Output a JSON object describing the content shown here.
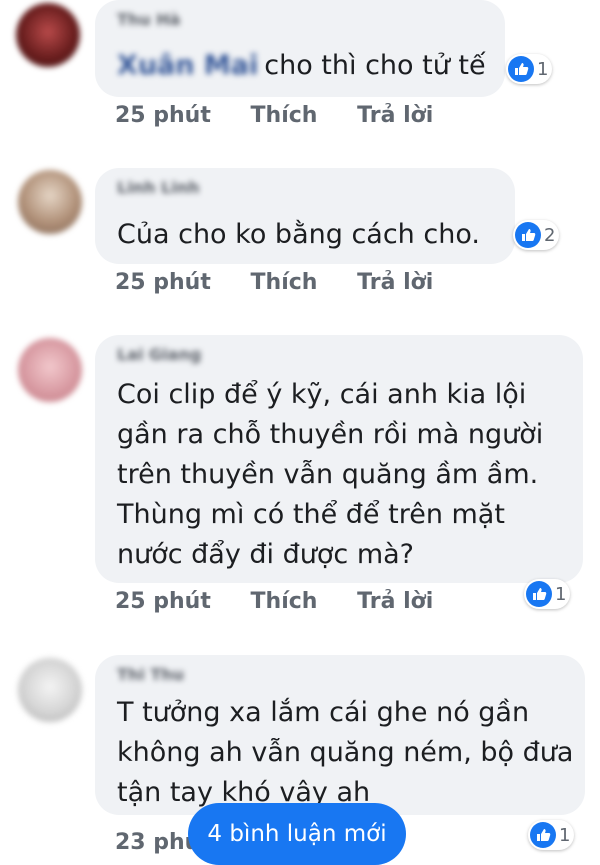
{
  "comments": [
    {
      "name": "Thu Hà",
      "mention": "Xuân Mai",
      "text": "cho thì cho tử tế",
      "reaction_count": "1",
      "time": "25 phút",
      "like": "Thích",
      "reply": "Trả lời",
      "avatar_color": "#7a2a2a"
    },
    {
      "name": "Linh Linh",
      "text": "Của cho ko bằng cách cho.",
      "reaction_count": "2",
      "time": "25 phút",
      "like": "Thích",
      "reply": "Trả lời",
      "avatar_color": "#a08a78"
    },
    {
      "name": "Lai Giang",
      "lines": [
        "Coi clip để ý kỹ, cái anh kia lội",
        "gần ra chỗ thuyền rồi mà người",
        "trên thuyền vẫn quăng ầm ầm.",
        "Thùng mì có thể để trên mặt",
        "nước đẩy đi được mà?"
      ],
      "reaction_count": "1",
      "time": "25 phút",
      "like": "Thích",
      "reply": "Trả lời",
      "avatar_color": "#d9a0a8"
    },
    {
      "name": "Thi Thu",
      "lines": [
        "T tưởng xa lắm cái ghe nó gần",
        "không ah vẫn quăng ném, bộ đưa",
        "tận tay khó vậy ah"
      ],
      "reaction_count": "1",
      "time": "23 phút",
      "avatar_color": "#cfcfcf"
    }
  ],
  "new_comments_button": "4 bình luận mới",
  "colors": {
    "accent": "#1877f2",
    "bubble": "#f0f2f5"
  }
}
